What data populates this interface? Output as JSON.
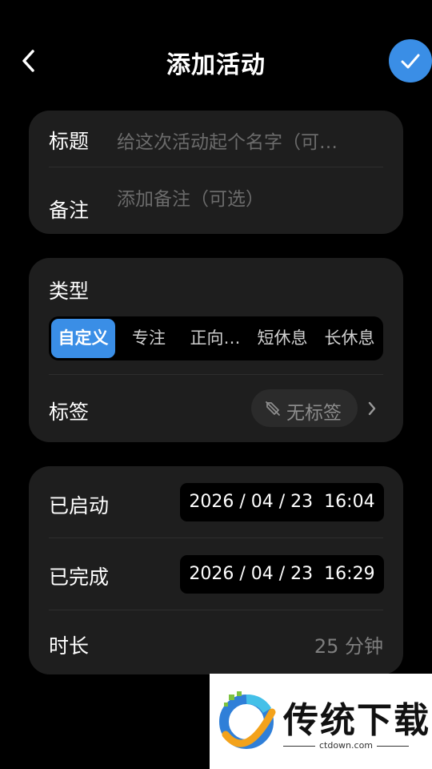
{
  "header": {
    "title": "添加活动",
    "back_icon": "chevron-left-icon",
    "confirm_icon": "check-icon",
    "accent_color": "#3a8ee6"
  },
  "details": {
    "title_label": "标题",
    "title_placeholder": "给这次活动起个名字（可…",
    "note_label": "备注",
    "note_placeholder": "添加备注（可选）"
  },
  "type_section": {
    "label": "类型",
    "options": [
      "自定义",
      "专注",
      "正向…",
      "短休息",
      "长休息"
    ],
    "selected": "自定义"
  },
  "tag_section": {
    "label": "标签",
    "value": "无标签",
    "icon": "tag-off-icon",
    "chevron": "chevron-right-icon"
  },
  "time_section": {
    "started_label": "已启动",
    "started_value": "2026 / 04 / 23  16:04",
    "finished_label": "已完成",
    "finished_value": "2026 / 04 / 23  16:29",
    "duration_label": "时长",
    "duration_value": "25 分钟"
  },
  "watermark": {
    "name": "传统下载",
    "url": "ctdown.com"
  }
}
